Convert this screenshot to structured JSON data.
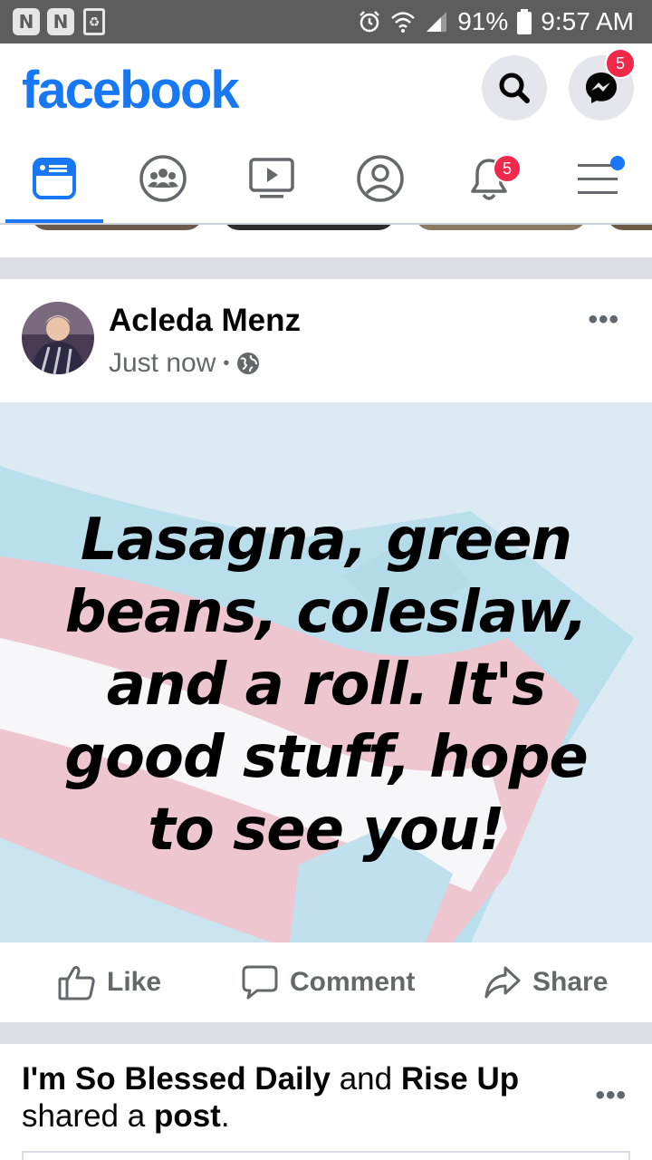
{
  "status_bar": {
    "battery": "91%",
    "time": "9:57 AM",
    "icons": [
      "notification-app-icon",
      "notification-app-icon",
      "recycle-icon",
      "alarm-icon",
      "wifi-icon",
      "signal-icon",
      "battery-icon"
    ]
  },
  "header": {
    "logo": "facebook",
    "messenger_badge": "5",
    "brand_color": "#1877f2"
  },
  "tabs": {
    "items": [
      "news-feed-icon",
      "groups-icon",
      "watch-icon",
      "profile-icon",
      "notifications-icon",
      "menu-icon"
    ],
    "active_index": 0,
    "notifications_badge": "5"
  },
  "post": {
    "author": "Acleda Menz",
    "time": "Just now",
    "separator": "•",
    "audience_icon": "globe-icon",
    "more": "•••",
    "text": "Lasagna, green beans, coleslaw, and a roll. It's good stuff, hope to see you!",
    "actions": {
      "like": "Like",
      "comment": "Comment",
      "share": "Share"
    }
  },
  "next_post": {
    "actor1": "I'm So Blessed Daily",
    "and": " and ",
    "actor2": "Rise Up",
    "shared": "shared a ",
    "object": "post",
    "period": ".",
    "more": "•••"
  }
}
